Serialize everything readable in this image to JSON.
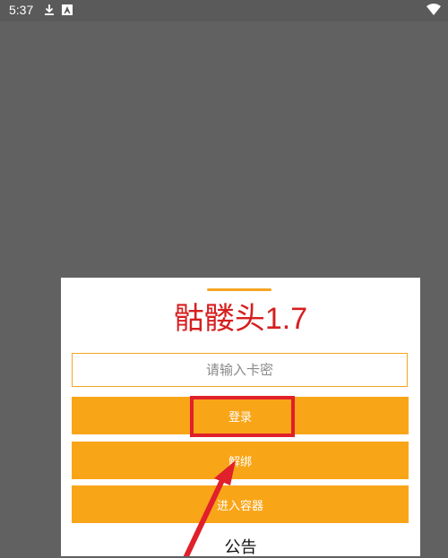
{
  "status_bar": {
    "time": "5:37",
    "icons": [
      "download-icon",
      "notification-icon",
      "wifi-icon"
    ]
  },
  "dialog": {
    "title": "骷髅头1.7",
    "card_input": {
      "placeholder": "请输入卡密",
      "value": ""
    },
    "buttons": {
      "login": "登录",
      "unbind": "解绑",
      "enter_container": "进入容器"
    },
    "notice": "公告"
  },
  "colors": {
    "background": "#616161",
    "accent": "#f9a518",
    "title": "#d61f1f",
    "annotation": "#e0202a"
  }
}
